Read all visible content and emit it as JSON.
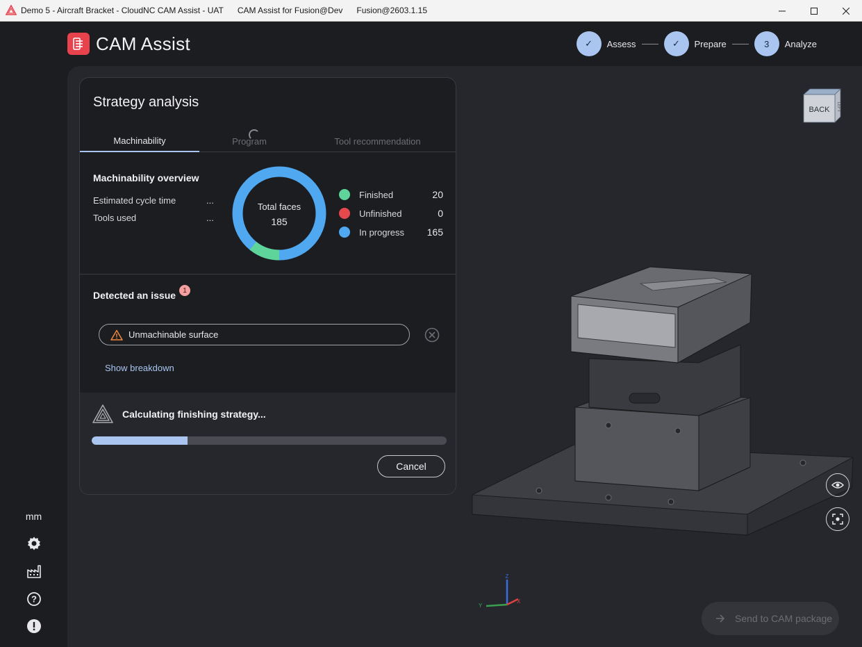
{
  "window": {
    "title_segments": [
      "Demo 5 - Aircraft Bracket - CloudNC CAM Assist - UAT",
      "CAM Assist for Fusion@Dev",
      "Fusion@2603.1.15"
    ]
  },
  "header": {
    "brand": "CAM Assist",
    "steps": [
      {
        "label": "Assess",
        "state": "done",
        "marker": "✓"
      },
      {
        "label": "Prepare",
        "state": "done",
        "marker": "✓"
      },
      {
        "label": "Analyze",
        "state": "current",
        "marker": "3"
      }
    ]
  },
  "rail": {
    "units_label": "mm",
    "icons": [
      "settings-icon",
      "factory-icon",
      "help-icon",
      "feedback-icon"
    ]
  },
  "panel": {
    "title": "Strategy analysis",
    "tabs": [
      {
        "label": "Machinability",
        "active": true
      },
      {
        "label": "Program",
        "active": false,
        "loading": true
      },
      {
        "label": "Tool recommendation",
        "active": false
      }
    ],
    "overview": {
      "title": "Machinability overview",
      "stats": [
        {
          "label": "Estimated cycle time",
          "value": "..."
        },
        {
          "label": "Tools used",
          "value": "..."
        }
      ],
      "donut": {
        "label": "Total faces",
        "total": "185",
        "finished": 20,
        "unfinished": 0,
        "in_progress": 165
      },
      "legend": [
        {
          "label": "Finished",
          "value": "20",
          "color": "#5fd49a"
        },
        {
          "label": "Unfinished",
          "value": "0",
          "color": "#e5484d"
        },
        {
          "label": "In progress",
          "value": "165",
          "color": "#4fa8f0"
        }
      ]
    },
    "issues": {
      "title": "Detected an issue",
      "count": "1",
      "chip_label": "Unmachinable surface",
      "breakdown_link": "Show breakdown"
    },
    "calculation": {
      "status": "Calculating finishing strategy...",
      "progress": 0.27,
      "cancel_label": "Cancel"
    }
  },
  "viewport": {
    "viewcube_face": "BACK",
    "viewcube_side": "LEFT",
    "axes": {
      "x": "X",
      "y": "Y",
      "z": "Z"
    },
    "send_label": "Send to CAM package"
  },
  "colors": {
    "accent": "#aac6f0",
    "brand": "#e8424d"
  }
}
